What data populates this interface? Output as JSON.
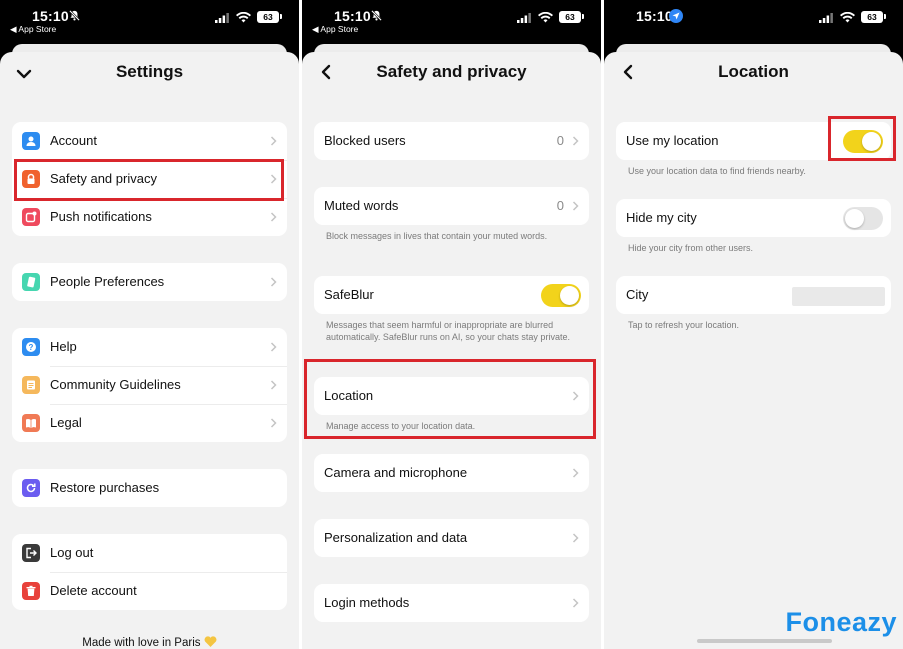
{
  "status_bar": {
    "time": "15:10",
    "back_app": "◀ App Store",
    "battery": "63"
  },
  "settings": {
    "title": "Settings",
    "group1": [
      {
        "label": "Account",
        "icon": "person-icon",
        "color": "#2d8cf0"
      },
      {
        "label": "Safety and privacy",
        "icon": "lock-icon",
        "color": "#f0622e"
      },
      {
        "label": "Push notifications",
        "icon": "notification-badge-icon",
        "color": "#ef4a5e"
      }
    ],
    "group2": [
      {
        "label": "People Preferences",
        "icon": "card-icon",
        "color": "#46d6b0"
      }
    ],
    "group3": [
      {
        "label": "Help",
        "icon": "question-icon",
        "color": "#2d8cf0"
      },
      {
        "label": "Community Guidelines",
        "icon": "list-icon",
        "color": "#f5b85c"
      },
      {
        "label": "Legal",
        "icon": "book-icon",
        "color": "#f07a55"
      }
    ],
    "group4": [
      {
        "label": "Restore purchases",
        "icon": "restore-icon",
        "color": "#6b5cf0"
      }
    ],
    "group5": [
      {
        "label": "Log out",
        "icon": "logout-icon",
        "color": "#3a3a3a"
      },
      {
        "label": "Delete account",
        "icon": "trash-icon",
        "color": "#e8413b"
      }
    ],
    "footer": "Made with love in Paris"
  },
  "safety": {
    "title": "Safety and privacy",
    "blocked_users": {
      "label": "Blocked users",
      "count": "0"
    },
    "muted_words": {
      "label": "Muted words",
      "count": "0",
      "note": "Block messages in lives that contain your muted words."
    },
    "safeblur": {
      "label": "SafeBlur",
      "on": true,
      "note": "Messages that seem harmful or inappropriate are blurred automatically. SafeBlur runs on AI, so your chats stay private."
    },
    "location": {
      "label": "Location",
      "note": "Manage access to your location data."
    },
    "camera": {
      "label": "Camera and microphone"
    },
    "personalization": {
      "label": "Personalization and data"
    },
    "login_methods": {
      "label": "Login methods"
    }
  },
  "location": {
    "title": "Location",
    "use_my_location": {
      "label": "Use my location",
      "on": true,
      "note": "Use your location data to find friends nearby."
    },
    "hide_my_city": {
      "label": "Hide my city",
      "on": false,
      "note": "Hide your city from other users."
    },
    "city": {
      "label": "City",
      "value": "",
      "note": "Tap to refresh your location."
    }
  },
  "watermark": "Foneazy",
  "colors": {
    "highlight": "#d9262c",
    "toggle_on": "#f2d31b",
    "toggle_off": "#e5e5e5",
    "watermark": "#1c8fe8"
  }
}
